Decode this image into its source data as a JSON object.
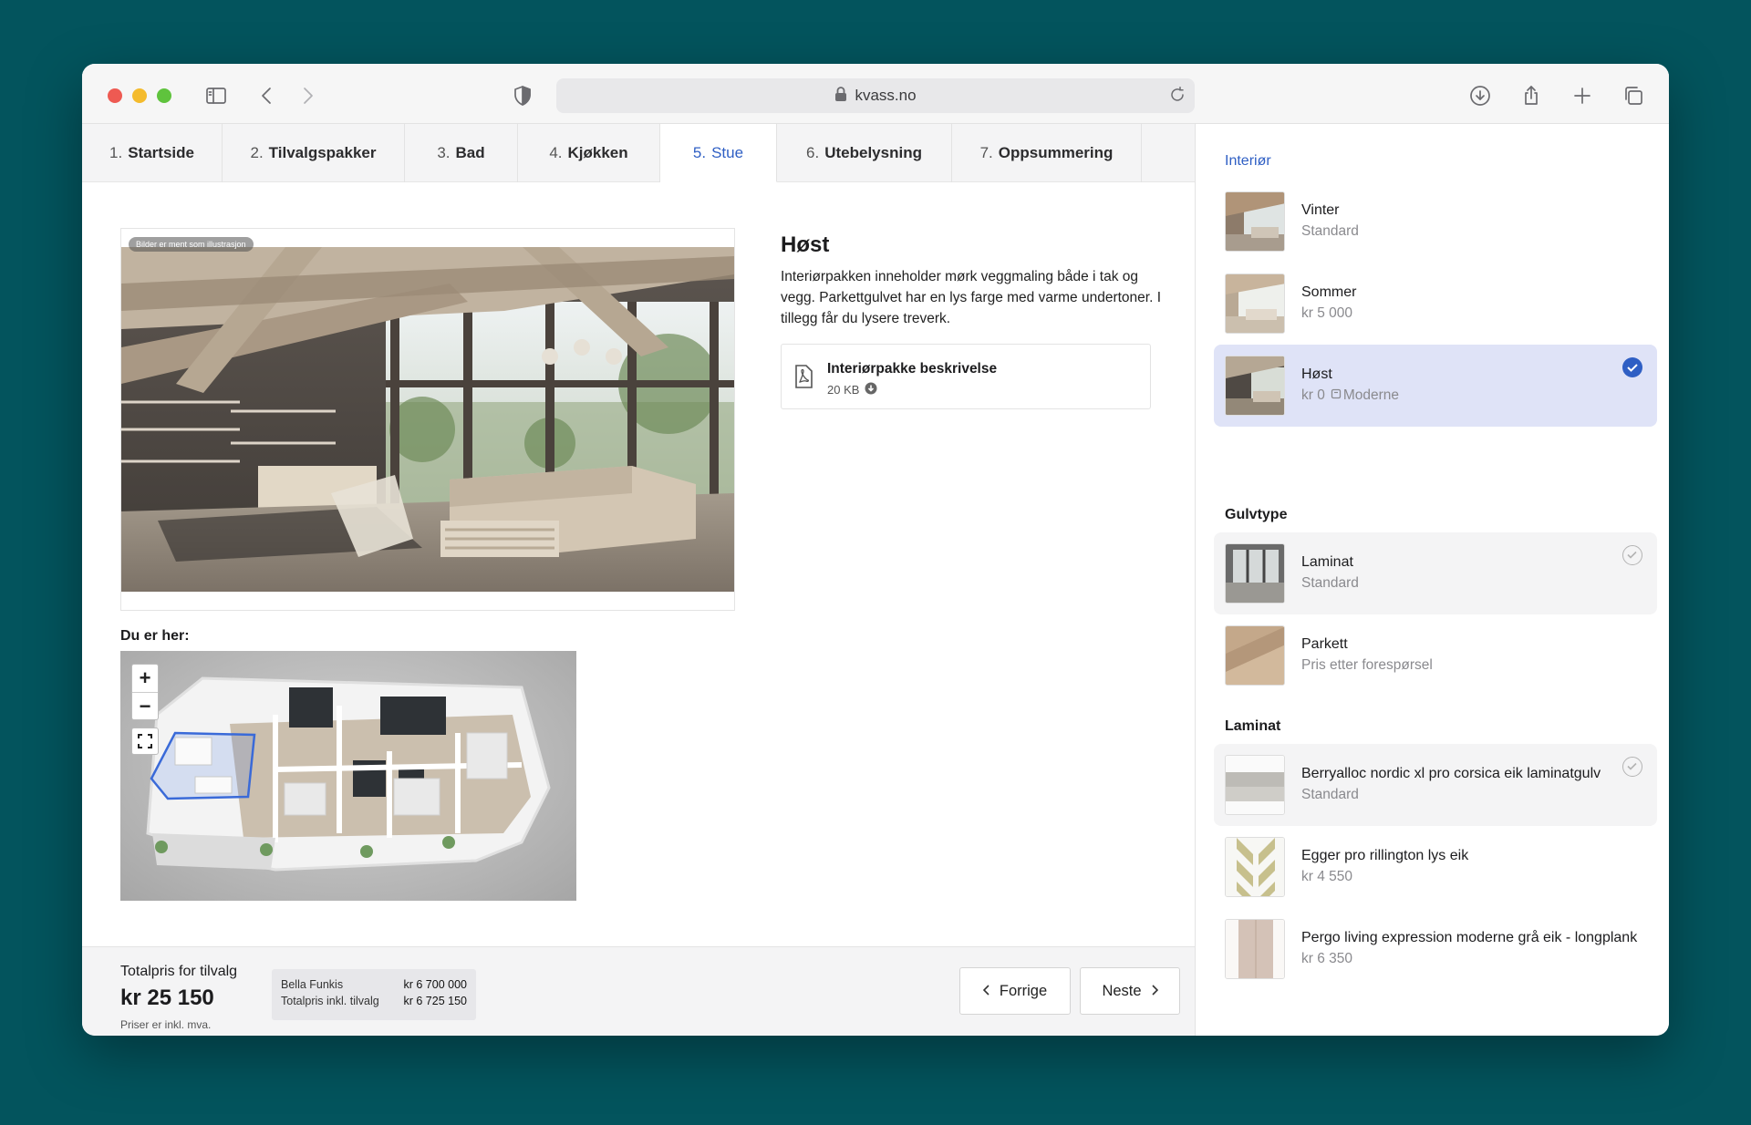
{
  "browser": {
    "url": "kvass.no"
  },
  "tabs": [
    {
      "num": "1.",
      "label": "Startside"
    },
    {
      "num": "2.",
      "label": "Tilvalgspakker"
    },
    {
      "num": "3.",
      "label": "Bad"
    },
    {
      "num": "4.",
      "label": "Kjøkken"
    },
    {
      "num": "5.",
      "label": "Stue"
    },
    {
      "num": "6.",
      "label": "Utebelysning"
    },
    {
      "num": "7.",
      "label": "Oppsummering"
    }
  ],
  "main": {
    "image_note": "Bilder er ment som illustrasjon",
    "title": "Høst",
    "description": "Interiørpakken inneholder mørk veggmaling både i tak og vegg. Parkettgulvet har en lys farge med varme undertoner. I tillegg får du lysere treverk.",
    "document": {
      "title": "Interiørpakke beskrivelse",
      "size": "20 KB"
    },
    "location_label": "Du er her:",
    "zoom_in": "+",
    "zoom_out": "−"
  },
  "footer": {
    "total_label": "Totalpris for tilvalg",
    "total_value": "kr 25 150",
    "vat_note": "Priser er inkl. mva.",
    "summary": [
      {
        "label": "Bella Funkis",
        "value": "kr 6 700 000"
      },
      {
        "label": "Totalpris inkl. tilvalg",
        "value": "kr 6 725 150"
      }
    ],
    "prev_label": "Forrige",
    "next_label": "Neste"
  },
  "sidebar": {
    "interior_title": "Interiør",
    "interior": [
      {
        "name": "Vinter",
        "sub": "Standard"
      },
      {
        "name": "Sommer",
        "sub": "kr 5 000"
      },
      {
        "name": "Høst",
        "sub": "kr 0",
        "tag": "Moderne",
        "selected": true
      }
    ],
    "floor_title": "Gulvtype",
    "floor": [
      {
        "name": "Laminat",
        "sub": "Standard",
        "selected": true
      },
      {
        "name": "Parkett",
        "sub": "Pris etter forespørsel"
      }
    ],
    "laminate_title": "Laminat",
    "laminate": [
      {
        "name": "Berryalloc nordic xl pro corsica eik laminatgulv",
        "sub": "Standard",
        "selected": true
      },
      {
        "name": "Egger pro rillington lys eik",
        "sub": "kr 4 550"
      },
      {
        "name": "Pergo living expression moderne grå eik - longplank",
        "sub": "kr 6 350"
      }
    ]
  },
  "colors": {
    "accent": "#2f5fc4",
    "selected_bg": "#dfe3f7",
    "background": "#03545d"
  }
}
